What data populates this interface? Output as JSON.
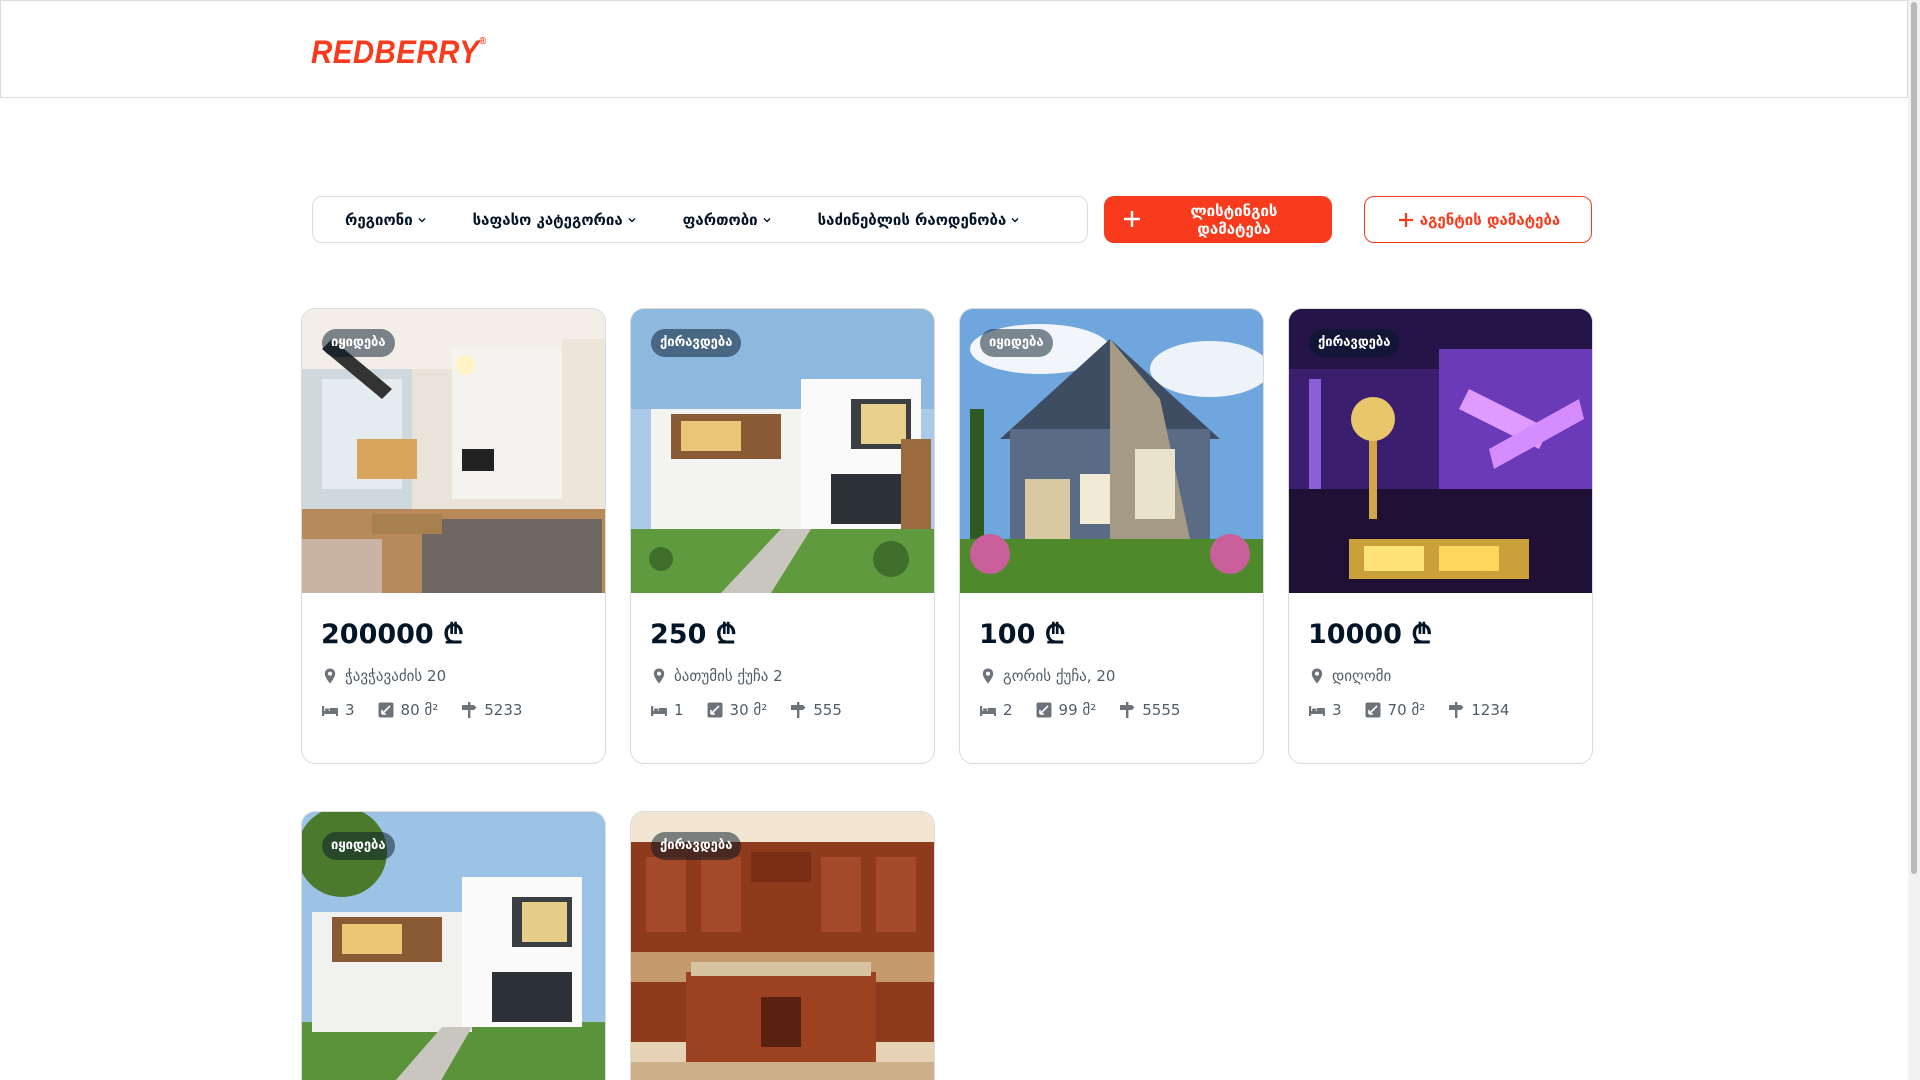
{
  "header": {
    "logo_text": "REDBERRY",
    "logo_mark": "®"
  },
  "filters": [
    {
      "label": "რეგიონი",
      "icon": "chevron-down-icon"
    },
    {
      "label": "საფასო კატეგორია",
      "icon": "chevron-down-icon"
    },
    {
      "label": "ფართობი",
      "icon": "chevron-down-icon"
    },
    {
      "label": "საძინებლის რაოდენობა",
      "icon": "chevron-down-icon"
    }
  ],
  "actions": {
    "add_listing": "ლისტინგის დამატება",
    "add_agent": "აგენტის დამატება"
  },
  "colors": {
    "accent": "#F93B1D",
    "text": "#021526",
    "border": "#DBDBDB"
  },
  "currency_symbol": "₾",
  "area_unit": "მ²",
  "listings": [
    {
      "badge": "იყიდება",
      "price": "200000 ₾",
      "address": "ჭავჭავაძის 20",
      "bedrooms": "3",
      "area": "80 მ²",
      "zip": "5233"
    },
    {
      "badge": "ქირავდება",
      "price": "250 ₾",
      "address": "ბათუმის ქუჩა 2",
      "bedrooms": "1",
      "area": "30 მ²",
      "zip": "555"
    },
    {
      "badge": "იყიდება",
      "price": "100 ₾",
      "address": "გორის ქუჩა, 20",
      "bedrooms": "2",
      "area": "99 მ²",
      "zip": "5555"
    },
    {
      "badge": "ქირავდება",
      "price": "10000 ₾",
      "address": "დიღომი",
      "bedrooms": "3",
      "area": "70 მ²",
      "zip": "1234"
    },
    {
      "badge": "იყიდება"
    },
    {
      "badge": "ქირავდება"
    }
  ]
}
